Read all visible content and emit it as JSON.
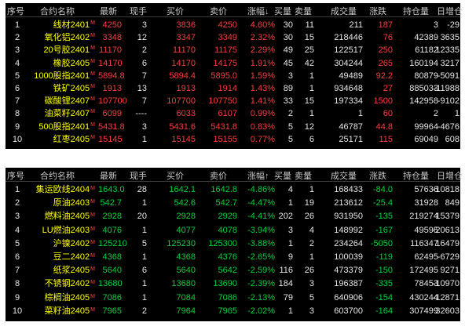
{
  "table1": {
    "headers": {
      "idx": "序号",
      "name": "合约名称",
      "last": "最新",
      "hand": "现手",
      "bid": "买价",
      "ask": "卖价",
      "chg": "涨幅",
      "chg_arrow": "↓",
      "bidv": "买量",
      "askv": "卖量",
      "vol": "成交量",
      "up": "涨跌",
      "oi": "持仓量",
      "doi": "日增仓"
    },
    "rows": [
      {
        "idx": "1",
        "name": "线材2401",
        "mark": "M",
        "last": "4250",
        "hand": "3",
        "bid": "3836",
        "ask": "4250",
        "chg": "4.60%",
        "bidv": "30",
        "askv": "11",
        "vol": "211",
        "up": "187",
        "oi": "3",
        "doi": "-29"
      },
      {
        "idx": "2",
        "name": "氧化铝2402",
        "mark": "M",
        "last": "3348",
        "hand": "12",
        "bid": "3347",
        "ask": "3349",
        "chg": "2.32%",
        "bidv": "30",
        "askv": "15",
        "vol": "218446",
        "up": "76",
        "oi": "42389",
        "doi": "3635"
      },
      {
        "idx": "3",
        "name": "20号胶2401",
        "mark": "M",
        "last": "11170",
        "hand": "2",
        "bid": "11170",
        "ask": "11175",
        "chg": "2.29%",
        "bidv": "49",
        "askv": "25",
        "vol": "122517",
        "up": "250",
        "oi": "61182",
        "doi": "12335"
      },
      {
        "idx": "4",
        "name": "橡胶2405",
        "mark": "M",
        "last": "14170",
        "hand": "6",
        "bid": "14170",
        "ask": "14175",
        "chg": "1.91%",
        "bidv": "45",
        "askv": "42",
        "vol": "304244",
        "up": "265",
        "oi": "160194",
        "doi": "3217"
      },
      {
        "idx": "5",
        "name": "1000股指2401",
        "mark": "M",
        "last": "5894.8",
        "hand": "7",
        "bid": "5894.4",
        "ask": "5895.0",
        "chg": "1.59%",
        "bidv": "3",
        "askv": "1",
        "vol": "49489",
        "up": "92.2",
        "oi": "80879",
        "doi": "-5091"
      },
      {
        "idx": "6",
        "name": "铁矿2405",
        "mark": "M",
        "last": "1913",
        "hand": "13",
        "bid": "1913",
        "ask": "1914",
        "chg": "1.43%",
        "bidv": "89",
        "askv": "1",
        "vol": "934648",
        "up": "27",
        "oi": "885033",
        "doi": "-11988"
      },
      {
        "idx": "7",
        "name": "碳酸锂2407",
        "mark": "M",
        "last": "107700",
        "hand": "7",
        "bid": "107700",
        "ask": "107750",
        "chg": "1.41%",
        "bidv": "33",
        "askv": "15",
        "vol": "197334",
        "up": "1500",
        "oi": "142958",
        "doi": "-9102"
      },
      {
        "idx": "8",
        "name": "油菜籽2407",
        "mark": "M",
        "last": "6099",
        "hand": "----",
        "bid": "6033",
        "ask": "6107",
        "chg": "0.99%",
        "bidv": "2",
        "askv": "1",
        "vol": "1",
        "up": "60",
        "oi": "2",
        "doi": "1"
      },
      {
        "idx": "9",
        "name": "500股指2401",
        "mark": "M",
        "last": "5431.8",
        "hand": "3",
        "bid": "5431.6",
        "ask": "5431.8",
        "chg": "0.83%",
        "bidv": "5",
        "askv": "12",
        "vol": "46787",
        "up": "44.8",
        "oi": "99964",
        "doi": "-4676"
      },
      {
        "idx": "10",
        "name": "红枣2405",
        "mark": "M",
        "last": "15145",
        "hand": "1",
        "bid": "15145",
        "ask": "15155",
        "chg": "0.77%",
        "bidv": "5",
        "askv": "6",
        "vol": "25171",
        "up": "115",
        "oi": "69049",
        "doi": "608"
      }
    ]
  },
  "table2": {
    "headers": {
      "idx": "序号",
      "name": "合约名称",
      "last": "最新",
      "hand": "现手",
      "bid": "买价",
      "ask": "卖价",
      "chg": "涨幅",
      "chg_arrow": "↑",
      "bidv": "买量",
      "askv": "卖量",
      "vol": "成交量",
      "up": "涨跌",
      "oi": "持仓量",
      "doi": "日增仓"
    },
    "rows": [
      {
        "idx": "1",
        "name": "集运欧线2404",
        "mark": "M",
        "last": "1643.0",
        "hand": "28",
        "bid": "1642.1",
        "ask": "1642.8",
        "chg": "-4.86%",
        "bidv": "4",
        "askv": "1",
        "vol": "168433",
        "up": "-84.0",
        "oi": "57636",
        "doi": "-10818"
      },
      {
        "idx": "2",
        "name": "原油2403",
        "mark": "M",
        "last": "542.7",
        "hand": "1",
        "bid": "542.6",
        "ask": "542.7",
        "chg": "-4.47%",
        "bidv": "1",
        "askv": "19",
        "vol": "213612",
        "up": "-25.4",
        "oi": "31928",
        "doi": "849"
      },
      {
        "idx": "3",
        "name": "燃料油2405",
        "mark": "M",
        "last": "2928",
        "hand": "20",
        "bid": "2928",
        "ask": "2929",
        "chg": "-4.41%",
        "bidv": "202",
        "askv": "26",
        "vol": "931950",
        "up": "-135",
        "oi": "219274",
        "doi": "15379"
      },
      {
        "idx": "4",
        "name": "LU燃油2403",
        "mark": "M",
        "last": "4076",
        "hand": "1",
        "bid": "4077",
        "ask": "4078",
        "chg": "-3.94%",
        "bidv": "3",
        "askv": "4",
        "vol": "148992",
        "up": "-167",
        "oi": "49595",
        "doi": "-20613"
      },
      {
        "idx": "5",
        "name": "沪镍2402",
        "mark": "M",
        "last": "125210",
        "hand": "5",
        "bid": "125230",
        "ask": "125300",
        "chg": "-3.88%",
        "bidv": "1",
        "askv": "2",
        "vol": "234264",
        "up": "-5050",
        "oi": "116347",
        "doi": "16479"
      },
      {
        "idx": "6",
        "name": "豆二2402",
        "mark": "M",
        "last": "4368",
        "hand": "1",
        "bid": "4368",
        "ask": "4376",
        "chg": "-2.65%",
        "bidv": "9",
        "askv": "1",
        "vol": "100039",
        "up": "-119",
        "oi": "62495",
        "doi": "-6729"
      },
      {
        "idx": "7",
        "name": "纸浆2405",
        "mark": "M",
        "last": "5640",
        "hand": "6",
        "bid": "5640",
        "ask": "5642",
        "chg": "-2.59%",
        "bidv": "116",
        "askv": "26",
        "vol": "473379",
        "up": "-150",
        "oi": "172495",
        "doi": "9271"
      },
      {
        "idx": "8",
        "name": "不锈钢2402",
        "mark": "M",
        "last": "13680",
        "hand": "1",
        "bid": "13680",
        "ask": "13690",
        "chg": "-2.39%",
        "bidv": "184",
        "askv": "3",
        "vol": "196387",
        "up": "-335",
        "oi": "78453",
        "doi": "-10970"
      },
      {
        "idx": "9",
        "name": "棕榈油2405",
        "mark": "M",
        "last": "7086",
        "hand": "1",
        "bid": "7084",
        "ask": "7086",
        "chg": "-2.13%",
        "bidv": "79",
        "askv": "5",
        "vol": "640906",
        "up": "-154",
        "oi": "430244",
        "doi": "-12871"
      },
      {
        "idx": "10",
        "name": "菜籽油2405",
        "mark": "M",
        "last": "7965",
        "hand": "2",
        "bid": "7964",
        "ask": "7965",
        "chg": "-2.02%",
        "bidv": "1",
        "askv": "3",
        "vol": "603700",
        "up": "-164",
        "oi": "307499",
        "doi": "32603"
      }
    ]
  },
  "colors": {
    "up": "#ff3b3b",
    "down": "#00d23c",
    "name": "#ffff00",
    "background": "#000000",
    "text": "#e6e6e6"
  }
}
